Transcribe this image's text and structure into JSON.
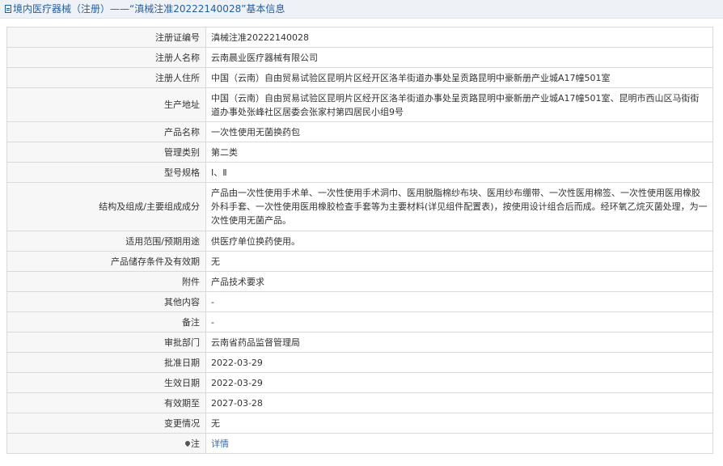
{
  "header": {
    "prefix": "境内医疗器械（注册）——",
    "title": "“滇械注准20222140028”基本信息"
  },
  "rows": [
    {
      "label": "注册证编号",
      "value": "滇械注准20222140028"
    },
    {
      "label": "注册人名称",
      "value": "云南晨业医疗器械有限公司"
    },
    {
      "label": "注册人住所",
      "value": "中国（云南）自由贸易试验区昆明片区经开区洛羊街道办事处呈贡路昆明中豪新册产业城A17幢501室"
    },
    {
      "label": "生产地址",
      "value": "中国（云南）自由贸易试验区昆明片区经开区洛羊街道办事处呈贡路昆明中豪新册产业城A17幢501室、昆明市西山区马街街道办事处张峰社区居委会张家村第四居民小组9号"
    },
    {
      "label": "产品名称",
      "value": "一次性使用无菌换药包"
    },
    {
      "label": "管理类别",
      "value": "第二类"
    },
    {
      "label": "型号规格",
      "value": "Ⅰ、Ⅱ"
    },
    {
      "label": "结构及组成/主要组成成分",
      "value": "产品由一次性使用手术单、一次性使用手术洞巾、医用脱脂棉纱布块、医用纱布绷带、一次性医用棉签、一次性使用医用橡胶外科手套、一次性使用医用橡胶检查手套等为主要材料(详见组件配置表)，按使用设计组合后而成。经环氧乙烷灭菌处理，为一次性使用无菌产品。"
    },
    {
      "label": "适用范围/预期用途",
      "value": "供医疗单位换药使用。"
    },
    {
      "label": "产品储存条件及有效期",
      "value": "无"
    },
    {
      "label": "附件",
      "value": "产品技术要求"
    },
    {
      "label": "其他内容",
      "value": "-"
    },
    {
      "label": "备注",
      "value": "-"
    },
    {
      "label": "审批部门",
      "value": "云南省药品监督管理局"
    },
    {
      "label": "批准日期",
      "value": "2022-03-29"
    },
    {
      "label": "生效日期",
      "value": "2022-03-29"
    },
    {
      "label": "有效期至",
      "value": "2027-03-28"
    },
    {
      "label": "变更情况",
      "value": "无"
    }
  ],
  "note": {
    "label": "注",
    "link_text": "详情",
    "icon": "map-pin-icon"
  }
}
